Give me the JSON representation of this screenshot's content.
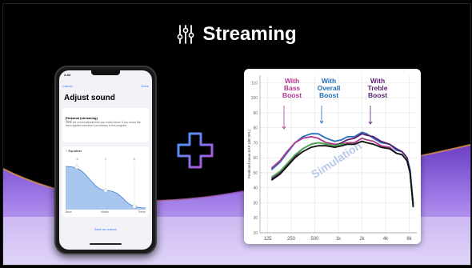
{
  "header": {
    "title": "Streaming",
    "icon": "equalizer-sliders-icon"
  },
  "phone": {
    "time": "2:44",
    "nav_left": "Cancel",
    "nav_right": "Done",
    "title": "Adjust sound",
    "preset_label": "Personal (streaming)",
    "preset_description": "Save the sound adjustments you made before if you would like them applied whenever you stream in this program.",
    "equalizer_label": "Equalizer",
    "eq_scale": [
      "+6",
      "0",
      "-6"
    ],
    "eq_bands": [
      "Bass",
      "Middle",
      "Treble"
    ],
    "save_custom": "Save as custom"
  },
  "plus_icon": "plus-gradient-icon",
  "chart_data": {
    "type": "line",
    "ylabel": "Predicted mean EAP (dB SPL)",
    "watermark": "Simulation",
    "y_ticks": [
      10,
      20,
      30,
      40,
      50,
      60,
      70,
      80,
      90,
      100,
      110
    ],
    "ylim": [
      10,
      115
    ],
    "x_ticks": [
      "125",
      "250",
      "500",
      "1k",
      "2k",
      "4k",
      "8k"
    ],
    "x_tick_values": [
      125,
      250,
      500,
      1000,
      2000,
      4000,
      8000
    ],
    "xlim": [
      100,
      10000
    ],
    "x_scale": "log",
    "grid": true,
    "annotations": [
      {
        "text": [
          "With",
          "Bass",
          "Boost"
        ],
        "color": "#b0358f"
      },
      {
        "text": [
          "With",
          "Overall",
          "Boost"
        ],
        "color": "#1f6fb8"
      },
      {
        "text": [
          "With",
          "Treble",
          "Boost"
        ],
        "color": "#5a1e6e"
      }
    ],
    "series": [
      {
        "color": "#2a6fba",
        "x": [
          140,
          180,
          220,
          280,
          350,
          450,
          550,
          700,
          900,
          1100,
          1300,
          1600,
          2000,
          2300,
          2800,
          3500,
          4500,
          5500,
          6500,
          7500,
          8200,
          9000
        ],
        "y": [
          52,
          57,
          63,
          70,
          74,
          76,
          76,
          73,
          71,
          72,
          74,
          74,
          77,
          76,
          73,
          70,
          69,
          65,
          64,
          60,
          52,
          30
        ]
      },
      {
        "color": "#b0358f",
        "x": [
          140,
          180,
          220,
          280,
          350,
          450,
          550,
          700,
          900,
          1100,
          1300,
          1600,
          2000,
          2300,
          2800,
          3500,
          4500,
          5500,
          6500,
          7500,
          8200,
          9000
        ],
        "y": [
          53,
          58,
          64,
          70,
          73,
          74,
          73,
          70,
          69,
          69,
          70,
          70,
          73,
          72,
          71,
          68,
          67,
          63,
          62,
          58,
          50,
          28
        ]
      },
      {
        "color": "#5a1e6e",
        "x": [
          140,
          180,
          220,
          280,
          350,
          450,
          550,
          700,
          900,
          1100,
          1300,
          1600,
          2000,
          2300,
          2800,
          3500,
          4500,
          5500,
          6500,
          7500,
          8200,
          9000
        ],
        "y": [
          46,
          50,
          55,
          61,
          66,
          69,
          70,
          69,
          68,
          70,
          72,
          73,
          76,
          75,
          74,
          71,
          69,
          66,
          64,
          60,
          51,
          29
        ]
      },
      {
        "color": "#4cae4c",
        "x": [
          140,
          180,
          220,
          280,
          350,
          450,
          550,
          700,
          900,
          1100,
          1300,
          1600,
          2000,
          2300,
          2800,
          3500,
          4500,
          5500,
          6500,
          7500,
          8200,
          9000
        ],
        "y": [
          47,
          51,
          56,
          62,
          66,
          69,
          70,
          69,
          68,
          69,
          69,
          69,
          71,
          70,
          69,
          67,
          66,
          63,
          62,
          58,
          50,
          28
        ]
      },
      {
        "color": "#111111",
        "x": [
          140,
          180,
          220,
          280,
          350,
          450,
          550,
          700,
          900,
          1100,
          1300,
          1600,
          2000,
          2300,
          2800,
          3500,
          4500,
          5500,
          6500,
          7500,
          8200,
          9000
        ],
        "y": [
          45,
          49,
          54,
          60,
          64,
          67,
          68,
          68,
          67,
          68,
          69,
          69,
          71,
          70,
          69,
          67,
          66,
          63,
          62,
          58,
          50,
          27
        ]
      }
    ]
  }
}
